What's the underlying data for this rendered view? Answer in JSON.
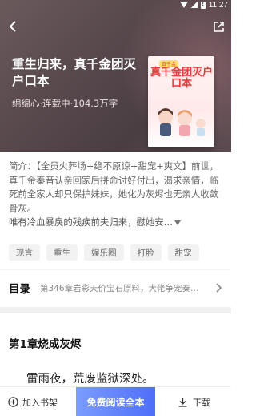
{
  "status_bar": {
    "time": "11:27"
  },
  "header": {
    "title": "重生归来，真千金团灭户口本",
    "meta": "绵绵心·连载中·104.3万字"
  },
  "cover": {
    "tag": "真千金",
    "title_art": "真千金团灭户口本"
  },
  "description": {
    "text": "简介：【全员火葬场+绝不原谅+甜宠+爽文】前世，真千金秦音认亲回家后拼命讨好付出，渴求亲情，临死前全家人却只保护妹妹，她化为灰烬也无亲人收敛骨灰。",
    "more": "唯有冷血暴戾的残疾前夫归来，慰她安…"
  },
  "tags": [
    "现言",
    "重生",
    "娱乐圈",
    "打脸",
    "甜宠"
  ],
  "toc": {
    "label": "目录",
    "latest": "第346章岩彩天价宝石原料，大佬争宠秦…"
  },
  "chapter": {
    "title": "第1章烧成灰烬",
    "first_line": "雷雨夜，荒废监狱深处。"
  },
  "bottom_bar": {
    "add_shelf": "加入书架",
    "read_free": "免费阅读全本",
    "download": "下载"
  }
}
